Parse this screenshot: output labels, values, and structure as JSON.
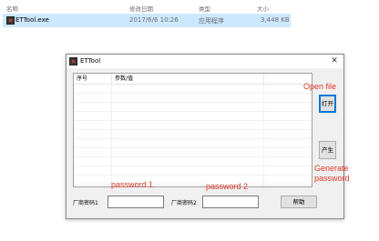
{
  "explorer": {
    "columns": {
      "name": "名称",
      "modified": "修改日期",
      "type": "类型",
      "size": "大小"
    },
    "file": {
      "name": "ETTool.exe",
      "modified": "2017/6/6 10:26",
      "type": "应用程序",
      "size": "3,448 KB",
      "icon": "app-icon"
    },
    "selection_color": "#cce8ff"
  },
  "window": {
    "title": "ETTool",
    "close_glyph": "✕",
    "list": {
      "columns": [
        "序号",
        "参数/值"
      ],
      "rows": []
    },
    "buttons": {
      "open": "打开",
      "generate": "产生",
      "help": "帮助"
    },
    "fields": {
      "vendor_password_1": {
        "label": "厂商密码1",
        "value": ""
      },
      "vendor_password_2": {
        "label": "厂商密码2",
        "value": ""
      }
    }
  },
  "annotations": {
    "open_file": "Open file",
    "generate_password": "Generate password",
    "password_1": "password 1",
    "password_2": "password 2",
    "color": "#e23a2c"
  }
}
